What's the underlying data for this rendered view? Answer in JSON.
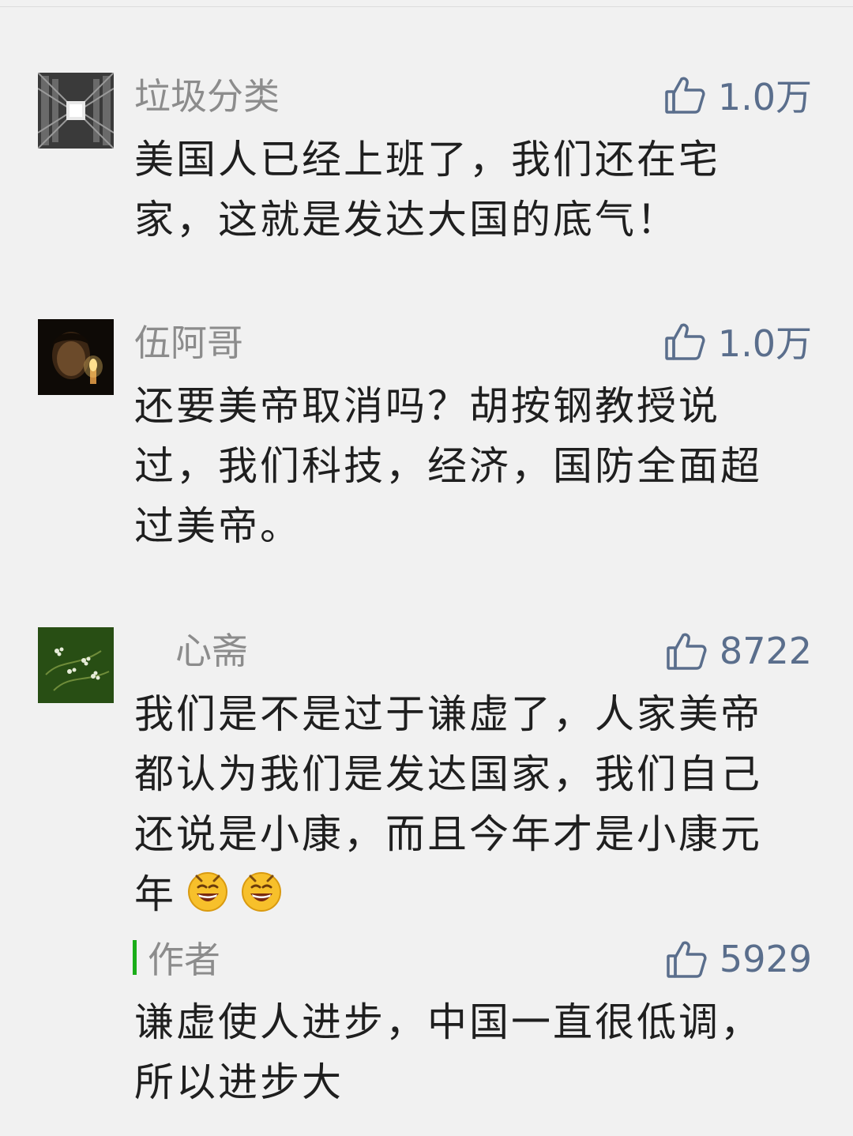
{
  "comments": [
    {
      "nickname": "垃圾分类",
      "likes": "1.0万",
      "text": "美国人已经上班了，我们还在宅家，这就是发达大国的底气！"
    },
    {
      "nickname": "伍阿哥",
      "likes": "1.0万",
      "text": "还要美帝取消吗？胡按钢教授说过，我们科技，经济，国防全面超过美帝。"
    },
    {
      "nickname": "心斋",
      "likes": "8722",
      "text": "我们是不是过于谦虚了，人家美帝都认为我们是发达国家，我们自己还说是小康，而且今年才是小康元年",
      "reply": {
        "author": "作者",
        "likes": "5929",
        "text": "谦虚使人进步，中国一直很低调，所以进步大"
      }
    }
  ],
  "icons": {
    "like": "thumbs-up-icon",
    "emoji": "grinning-face-icon"
  },
  "colors": {
    "background": "#f1f1f1",
    "nickname": "#8c8c8c",
    "like": "#5a6e8c",
    "body_text": "#1f1f1f",
    "author_bar": "#1aad19"
  }
}
